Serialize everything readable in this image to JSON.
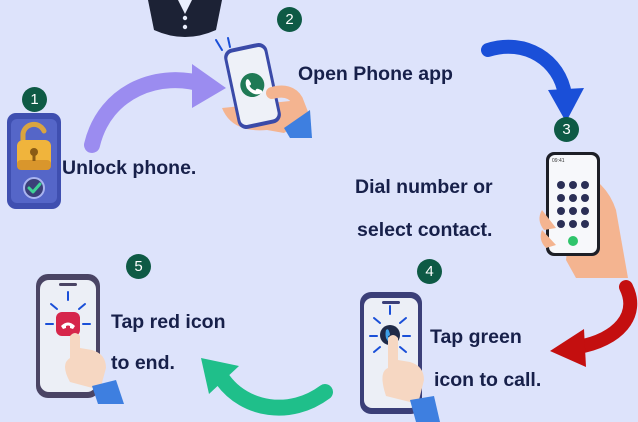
{
  "steps": [
    {
      "number": "1",
      "text": [
        "Unlock phone."
      ]
    },
    {
      "number": "2",
      "text": [
        "Open Phone app"
      ]
    },
    {
      "number": "3",
      "text": [
        "Dial number or",
        "select contact."
      ]
    },
    {
      "number": "4",
      "text": [
        "Tap green",
        "icon to call."
      ]
    },
    {
      "number": "5",
      "text": [
        "Tap red icon",
        "to end."
      ]
    }
  ],
  "dialer_time": "09:41",
  "colors": {
    "background": "#dde3fb",
    "badge": "#0e5a45",
    "arrow_purple": "#9b8cf0",
    "arrow_blue": "#1a4fd8",
    "arrow_red": "#c40f0f",
    "arrow_green": "#1fbf8a"
  }
}
